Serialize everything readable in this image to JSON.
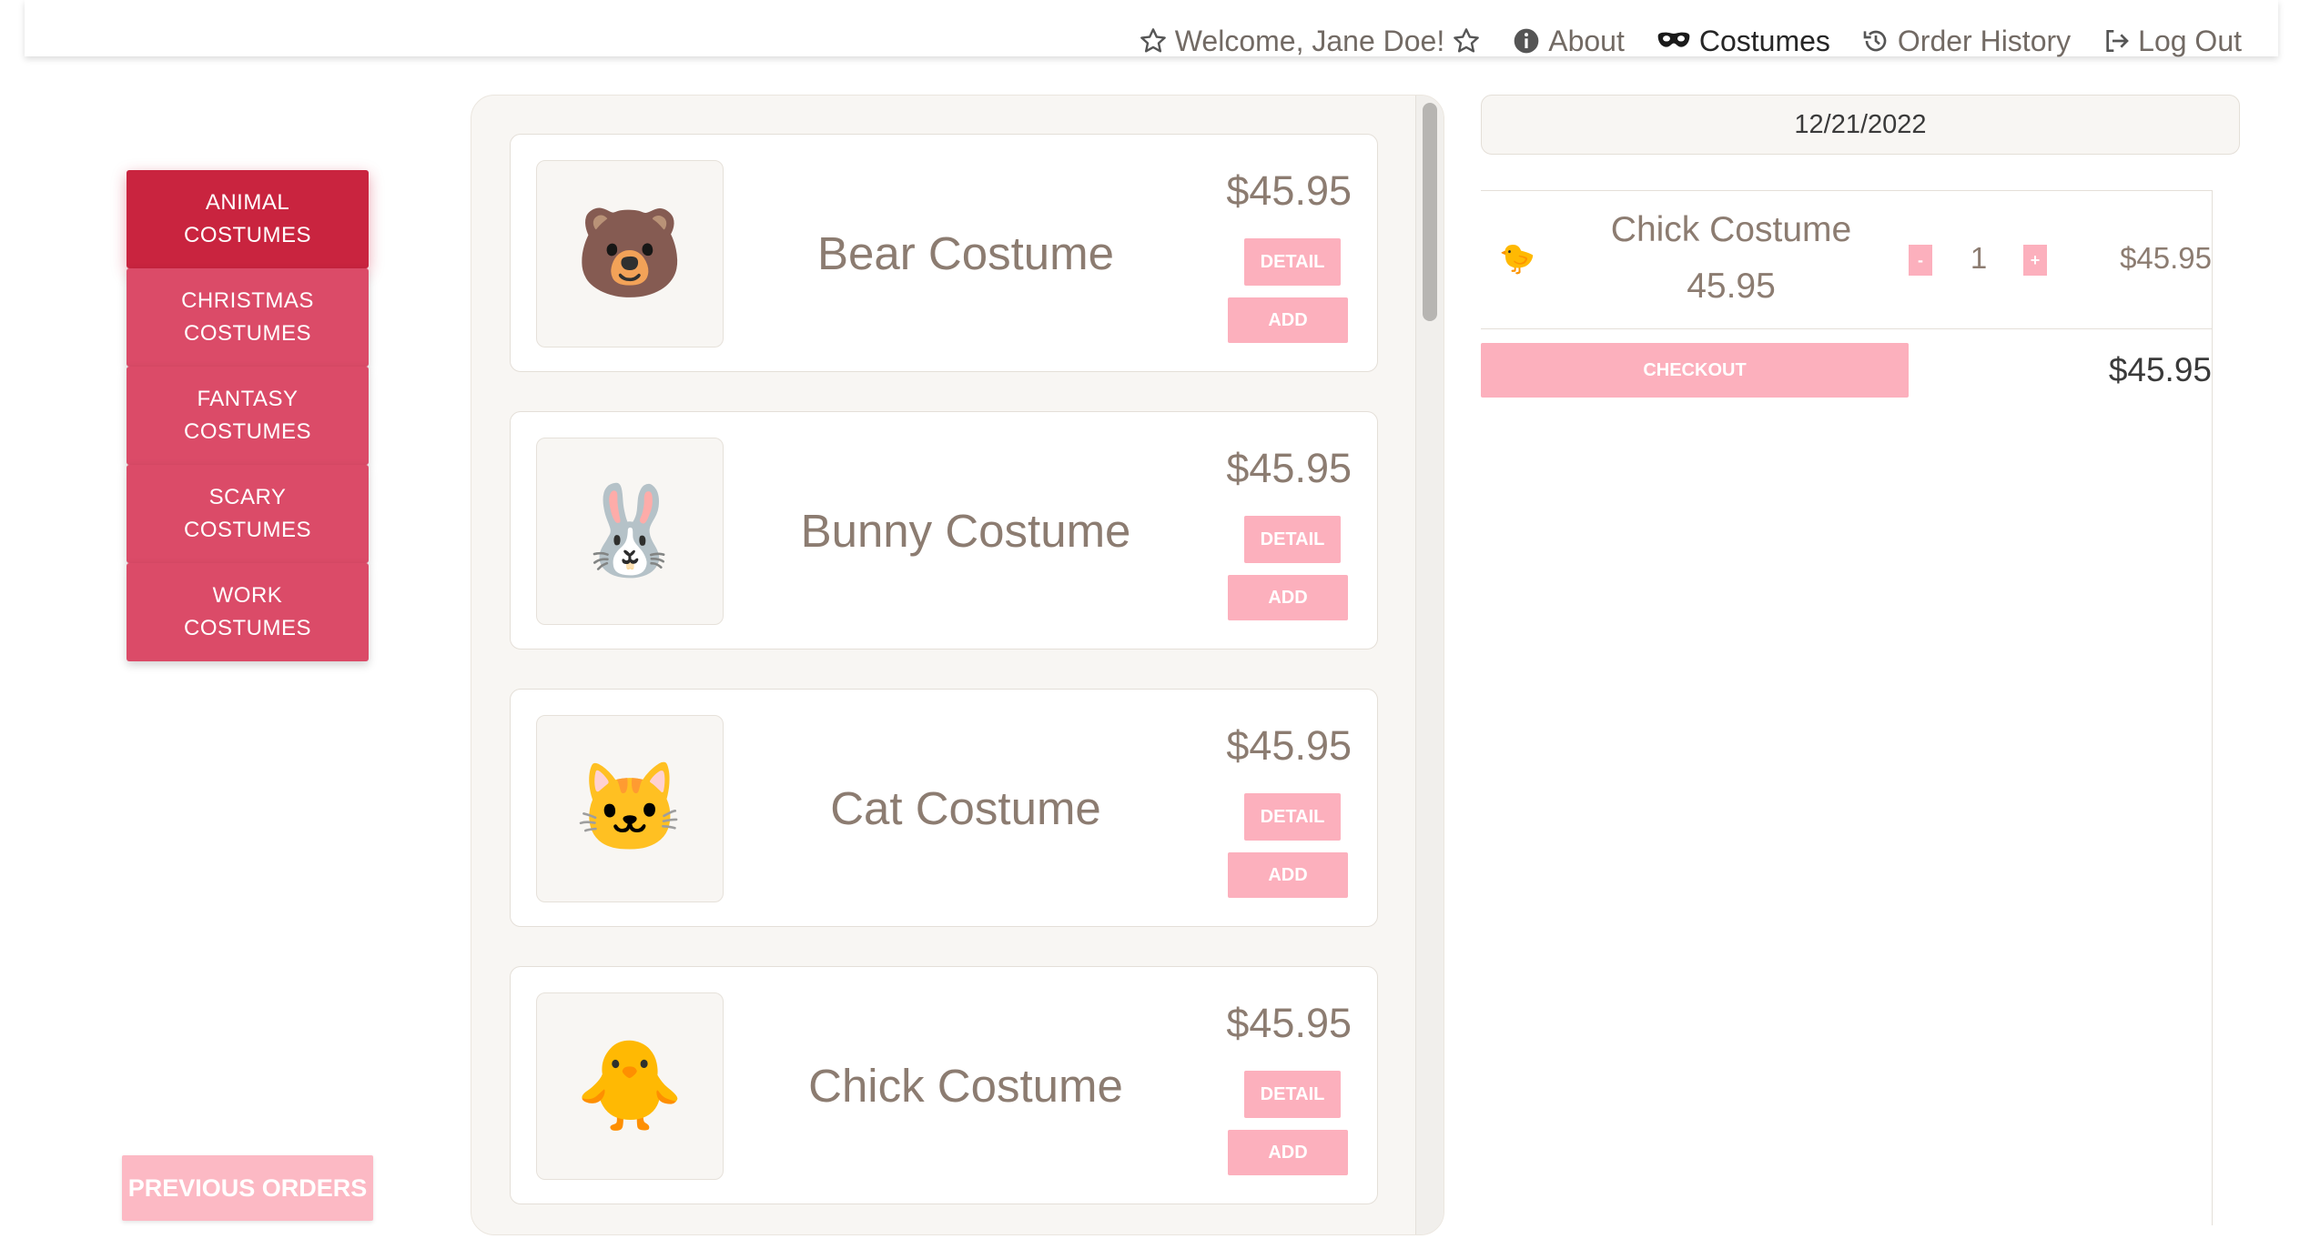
{
  "nav": {
    "welcome": "Welcome, Jane Doe!",
    "about": "About",
    "costumes": "Costumes",
    "order_history": "Order History",
    "logout": "Log Out",
    "active": "Costumes"
  },
  "categories": [
    {
      "label": "ANIMAL\nCOSTUMES",
      "active": true
    },
    {
      "label": "CHRISTMAS\nCOSTUMES",
      "active": false
    },
    {
      "label": "FANTASY\nCOSTUMES",
      "active": false
    },
    {
      "label": "SCARY\nCOSTUMES",
      "active": false
    },
    {
      "label": "WORK\nCOSTUMES",
      "active": false
    }
  ],
  "previous_orders_label": "PREVIOUS ORDERS",
  "products": [
    {
      "name": "Bear Costume",
      "price": "$45.95",
      "emoji": "🐻",
      "icon": "bear-icon",
      "detail_label": "DETAIL",
      "add_label": "ADD"
    },
    {
      "name": "Bunny Costume",
      "price": "$45.95",
      "emoji": "🐰",
      "icon": "bunny-icon",
      "detail_label": "DETAIL",
      "add_label": "ADD"
    },
    {
      "name": "Cat Costume",
      "price": "$45.95",
      "emoji": "🐱",
      "icon": "cat-icon",
      "detail_label": "DETAIL",
      "add_label": "ADD"
    },
    {
      "name": "Chick Costume",
      "price": "$45.95",
      "emoji": "🐥",
      "icon": "chick-icon",
      "detail_label": "DETAIL",
      "add_label": "ADD"
    }
  ],
  "cart": {
    "date": "12/21/2022",
    "items": [
      {
        "emoji": "🐤",
        "icon": "chick-icon",
        "name": "Chick Costume",
        "unit_price": "45.95",
        "minus_label": "-",
        "qty": "1",
        "plus_label": "+",
        "line_total": "$45.95"
      }
    ],
    "checkout_label": "CHECKOUT",
    "total": "$45.95"
  },
  "colors": {
    "accent": "#c9243f",
    "category": "#db4b68",
    "button_light": "#fcb0bd",
    "panel_bg": "#f8f6f3",
    "text_muted": "#8c7c71"
  }
}
